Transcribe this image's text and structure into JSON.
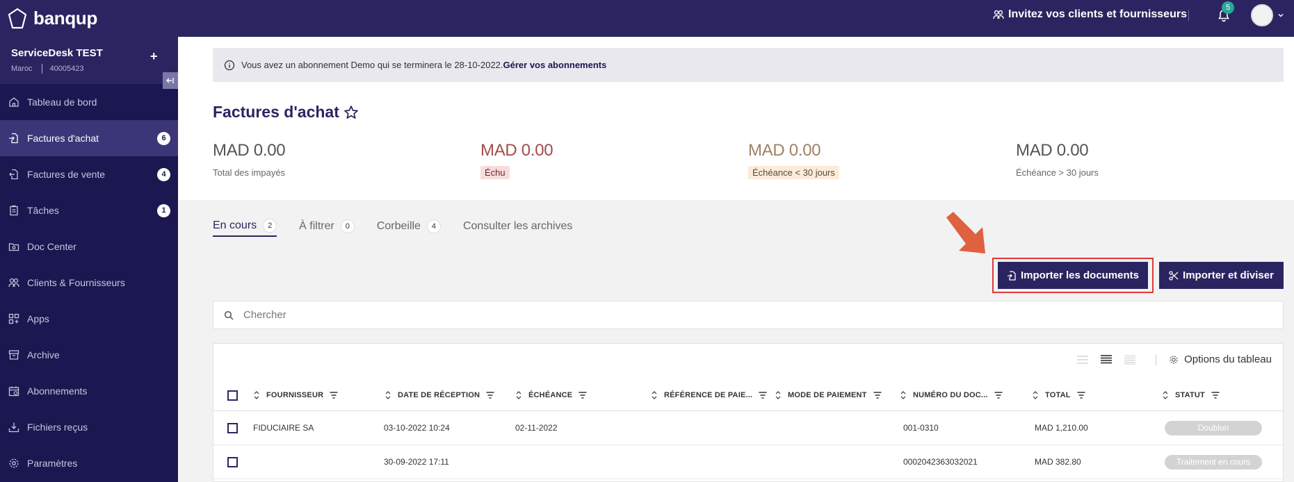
{
  "header": {
    "brand": "banqup",
    "invite_label": "Invitez vos clients et fournisseurs",
    "notif_count": "5"
  },
  "sidebar": {
    "company": "ServiceDesk TEST",
    "country": "Maroc",
    "company_id": "40005423",
    "items": [
      {
        "label": "Tableau de bord",
        "icon": "home-icon"
      },
      {
        "label": "Factures d'achat",
        "icon": "file-import-icon",
        "badge": "6",
        "active": true
      },
      {
        "label": "Factures de vente",
        "icon": "file-export-icon",
        "badge": "4"
      },
      {
        "label": "Tâches",
        "icon": "clipboard-icon",
        "badge": "1"
      },
      {
        "label": "Doc Center",
        "icon": "doc-center-icon"
      },
      {
        "label": "Clients & Fournisseurs",
        "icon": "people-icon"
      },
      {
        "label": "Apps",
        "icon": "apps-icon"
      },
      {
        "label": "Archive",
        "icon": "archive-icon"
      },
      {
        "label": "Abonnements",
        "icon": "calendar-icon"
      },
      {
        "label": "Fichiers reçus",
        "icon": "inbox-download-icon"
      },
      {
        "label": "Paramètres",
        "icon": "gear-icon"
      }
    ]
  },
  "banner": {
    "text": "Vous avez un abonnement Demo qui se terminera le 28-10-2022.",
    "link": "Gérer vos abonnements"
  },
  "page": {
    "title": "Factures d'achat"
  },
  "kpis": [
    {
      "value": "MAD 0.00",
      "label": "Total des impayés"
    },
    {
      "value": "MAD 0.00",
      "label": "Échu"
    },
    {
      "value": "MAD 0.00",
      "label": "Échéance < 30 jours"
    },
    {
      "value": "MAD 0.00",
      "label": "Échéance > 30 jours"
    }
  ],
  "tabs": [
    {
      "label": "En cours",
      "count": "2",
      "active": true
    },
    {
      "label": "À filtrer",
      "count": "0"
    },
    {
      "label": "Corbeille",
      "count": "4"
    },
    {
      "label": "Consulter les archives"
    }
  ],
  "actions": {
    "import": "Importer les documents",
    "import_split": "Importer et diviser"
  },
  "search": {
    "placeholder": "Chercher"
  },
  "table": {
    "options_label": "Options du tableau",
    "columns": [
      "FOURNISSEUR",
      "DATE DE RÉCEPTION",
      "ÉCHÉANCE",
      "RÉFÉRENCE DE PAIE...",
      "MODE DE PAIEMENT",
      "NUMÉRO DU DOC...",
      "TOTAL",
      "STATUT"
    ],
    "rows": [
      {
        "supplier": "FIDUCIAIRE SA",
        "received": "03-10-2022 10:24",
        "due": "02-11-2022",
        "ref": "",
        "mode": "",
        "doc_number": "001-0310",
        "total": "MAD 1,210.00",
        "status": "Doublon"
      },
      {
        "supplier": "",
        "received": "30-09-2022 17:11",
        "due": "",
        "ref": "",
        "mode": "",
        "doc_number": "0002042363032021",
        "total": "MAD 382.80",
        "status": "Traitement en cours"
      }
    ]
  },
  "colors": {
    "brand_dark": "#1b1750",
    "brand": "#2a2560",
    "highlight_red": "#e0383a",
    "arrow_orange": "#e0613f"
  }
}
